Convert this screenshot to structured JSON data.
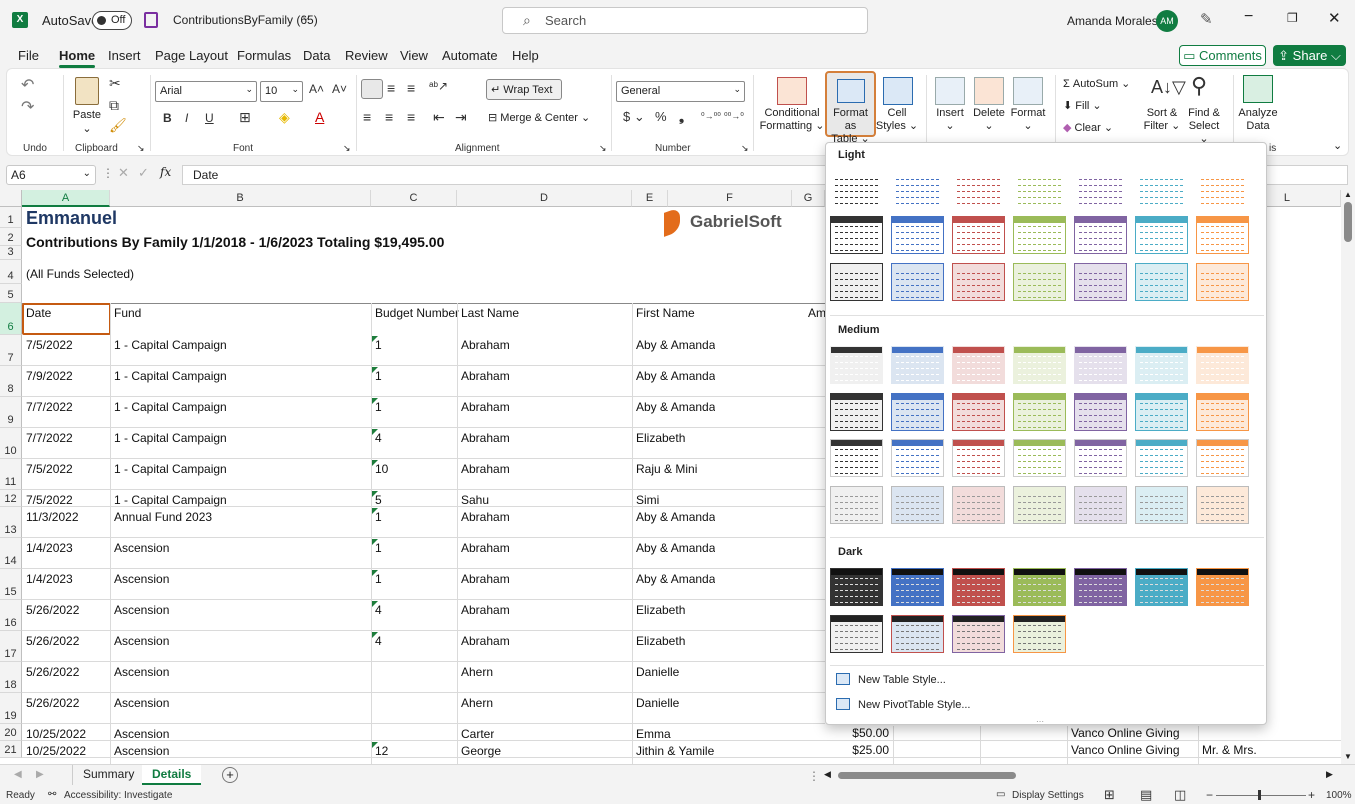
{
  "titlebar": {
    "autosave_label": "AutoSave",
    "autosave_state": "Off",
    "filename": "ContributionsByFamily (65)",
    "search_placeholder": "Search",
    "user_name": "Amanda Morales",
    "user_initials": "AM"
  },
  "menu": {
    "tabs": [
      "File",
      "Home",
      "Insert",
      "Page Layout",
      "Formulas",
      "Data",
      "Review",
      "View",
      "Automate",
      "Help"
    ],
    "active": "Home",
    "comments": "Comments",
    "share": "Share"
  },
  "ribbon": {
    "undo_group": "Undo",
    "clipboard_group": "Clipboard",
    "paste": "Paste",
    "font_group": "Font",
    "font_name": "Arial",
    "font_size": "10",
    "alignment_group": "Alignment",
    "wrap_text": "Wrap Text",
    "merge_center": "Merge & Center",
    "number_group": "Number",
    "number_format": "General",
    "conditional_formatting": [
      "Conditional",
      "Formatting"
    ],
    "format_as_table": [
      "Format as",
      "Table"
    ],
    "cell_styles": [
      "Cell",
      "Styles"
    ],
    "insert": "Insert",
    "delete": "Delete",
    "format": "Format",
    "autosum": "AutoSum",
    "fill": "Fill",
    "clear": "Clear",
    "sort_filter": [
      "Sort &",
      "Filter"
    ],
    "find_select": [
      "Find &",
      "Select"
    ],
    "analyze_data": [
      "Analyze",
      "Data"
    ],
    "analysis_group_fragment": "is"
  },
  "formula_bar": {
    "name_box": "A6",
    "fx": "fx",
    "value": "Date"
  },
  "columns": [
    "A",
    "B",
    "C",
    "D",
    "E",
    "F",
    "G",
    "L"
  ],
  "sheet": {
    "title": "Emmanuel",
    "subtitle": "Contributions By Family 1/1/2018 - 1/6/2023 Totaling $19,495.00",
    "funds_note": "(All Funds Selected)",
    "logo": "GabrielSoft",
    "headers": {
      "date": "Date",
      "fund": "Fund",
      "budget": "Budget Number",
      "last": "Last Name",
      "first": "First Name",
      "amount_frag": "Am"
    },
    "rows": [
      {
        "num": "7",
        "date": "7/5/2022",
        "fund": "1 - Capital Campaign",
        "budget": "1",
        "last": "Abraham",
        "first": "Aby & Amanda"
      },
      {
        "num": "8",
        "date": "7/9/2022",
        "fund": "1 - Capital Campaign",
        "budget": "1",
        "last": "Abraham",
        "first": "Aby & Amanda"
      },
      {
        "num": "9",
        "date": "7/7/2022",
        "fund": "1 - Capital Campaign",
        "budget": "1",
        "last": "Abraham",
        "first": "Aby & Amanda"
      },
      {
        "num": "10",
        "date": "7/7/2022",
        "fund": "1 - Capital Campaign",
        "budget": "4",
        "last": "Abraham",
        "first": "Elizabeth"
      },
      {
        "num": "11",
        "date": "7/5/2022",
        "fund": "1 - Capital Campaign",
        "budget": "10",
        "last": "Abraham",
        "first": "Raju & Mini"
      },
      {
        "num": "12",
        "date": "7/5/2022",
        "fund": "1 - Capital Campaign",
        "budget": "5",
        "last": "Sahu",
        "first": "Simi"
      },
      {
        "num": "13",
        "date": "11/3/2022",
        "fund": "Annual Fund 2023",
        "budget": "1",
        "last": "Abraham",
        "first": "Aby & Amanda"
      },
      {
        "num": "14",
        "date": "1/4/2023",
        "fund": "Ascension",
        "budget": "1",
        "last": "Abraham",
        "first": "Aby & Amanda"
      },
      {
        "num": "15",
        "date": "1/4/2023",
        "fund": "Ascension",
        "budget": "1",
        "last": "Abraham",
        "first": "Aby & Amanda"
      },
      {
        "num": "16",
        "date": "5/26/2022",
        "fund": "Ascension",
        "budget": "4",
        "last": "Abraham",
        "first": "Elizabeth"
      },
      {
        "num": "17",
        "date": "5/26/2022",
        "fund": "Ascension",
        "budget": "4",
        "last": "Abraham",
        "first": "Elizabeth"
      },
      {
        "num": "18",
        "date": "5/26/2022",
        "fund": "Ascension",
        "budget": "",
        "last": "Ahern",
        "first": "Danielle"
      },
      {
        "num": "19",
        "date": "5/26/2022",
        "fund": "Ascension",
        "budget": "",
        "last": "Ahern",
        "first": "Danielle"
      },
      {
        "num": "20",
        "date": "10/25/2022",
        "fund": "Ascension",
        "budget": "",
        "last": "Carter",
        "first": "Emma",
        "amount": "$50.00",
        "method": "Vanco Online Giving",
        "extra": ""
      },
      {
        "num": "21",
        "date": "10/25/2022",
        "fund": "Ascension",
        "budget": "12",
        "last": "George",
        "first": "Jithin & Yamile",
        "amount": "$25.00",
        "method": "Vanco Online Giving",
        "extra": "Mr. & Mrs."
      }
    ],
    "row_labels_top": [
      "1",
      "2",
      "3",
      "4",
      "5",
      "6"
    ]
  },
  "sheets": {
    "tabs": [
      "Summary",
      "Details"
    ],
    "active": "Details"
  },
  "status": {
    "ready": "Ready",
    "accessibility": "Accessibility: Investigate",
    "display_settings": "Display Settings",
    "zoom": "100%"
  },
  "gallery": {
    "sections": [
      "Light",
      "Medium",
      "Dark"
    ],
    "new_table_style": "New Table Style...",
    "new_pivot_style": "New PivotTable Style...",
    "palette": [
      "#333333",
      "#4472c4",
      "#c0504d",
      "#9bbb59",
      "#8064a2",
      "#4bacc6",
      "#f79646"
    ],
    "palette_light": [
      "#f0f0f0",
      "#dbe5f1",
      "#f2dcdb",
      "#ebf1dd",
      "#e5e0ec",
      "#dbeef3",
      "#fde9d9"
    ]
  }
}
